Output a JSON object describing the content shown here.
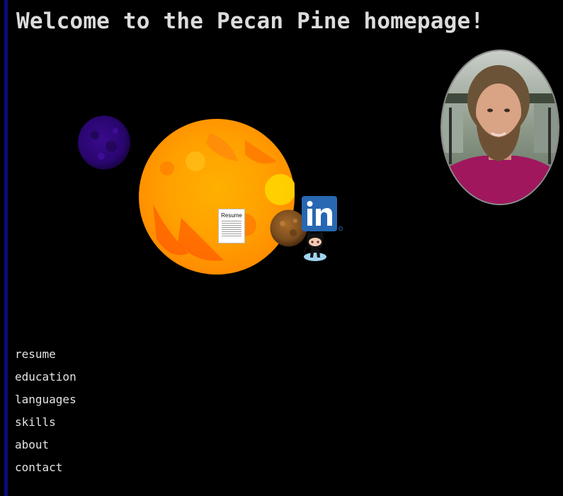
{
  "header": {
    "title": "Welcome to the Pecan Pine homepage!"
  },
  "colors": {
    "background": "#000000",
    "left_bar": "#0d0a7a",
    "text": "#d9d9d9",
    "sun_core": "#ffa500",
    "linkedin_blue": "#2867b2"
  },
  "solar_system": {
    "sun": {
      "icon": "sun-icon"
    },
    "small_planet": {
      "icon": "purple-planet-icon"
    },
    "brown_planet": {
      "icon": "brown-planet-icon"
    },
    "resume": {
      "icon": "resume-document-icon",
      "label": "Resume"
    },
    "linkedin": {
      "icon": "linkedin-icon",
      "text": "in"
    },
    "github": {
      "icon": "github-octocat-icon"
    }
  },
  "profile": {
    "icon": "profile-photo"
  },
  "nav": {
    "items": [
      {
        "label": "resume"
      },
      {
        "label": "education"
      },
      {
        "label": "languages"
      },
      {
        "label": "skills"
      },
      {
        "label": "about"
      },
      {
        "label": "contact"
      }
    ]
  }
}
